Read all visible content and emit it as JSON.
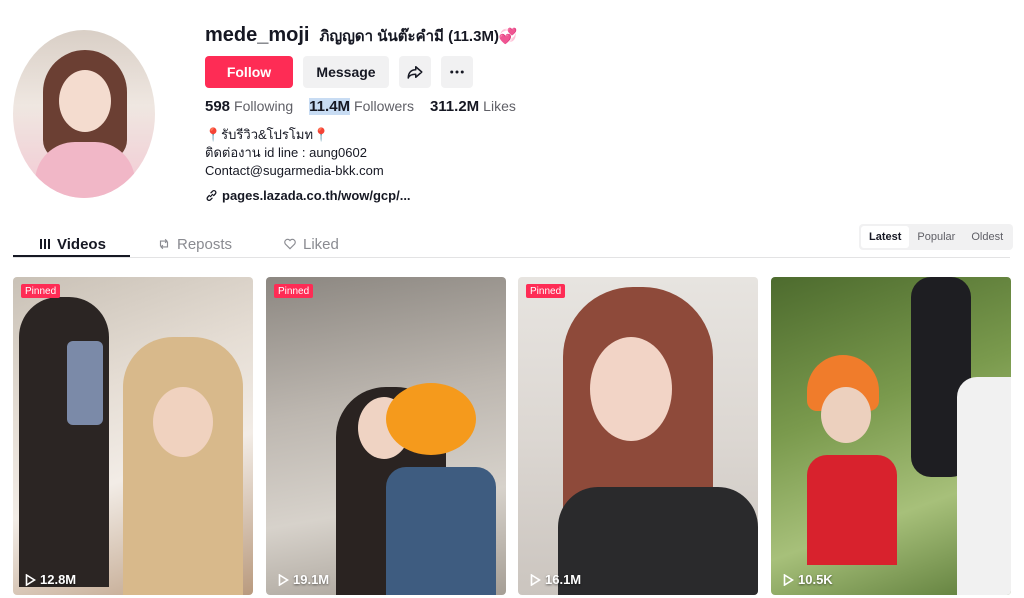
{
  "profile": {
    "username": "mede_moji",
    "nickname": "ภิญญดา นันต๊ะคำมี (11.3M)💞",
    "follow_label": "Follow",
    "message_label": "Message",
    "stats": {
      "following_value": "598",
      "following_label": "Following",
      "followers_value": "11.4M",
      "followers_label": "Followers",
      "likes_value": "311.2M",
      "likes_label": "Likes"
    },
    "bio": {
      "line1": "📍รับรีวิว&โปรโมท📍",
      "line2": "ติดต่องาน id line : aung0602",
      "line3": "Contact@sugarmedia-bkk.com"
    },
    "link": "pages.lazada.co.th/wow/gcp/..."
  },
  "tabs": [
    {
      "label": "Videos",
      "icon": "grid-icon"
    },
    {
      "label": "Reposts",
      "icon": "repost-icon"
    },
    {
      "label": "Liked",
      "icon": "heart-icon"
    }
  ],
  "sort": [
    "Latest",
    "Popular",
    "Oldest"
  ],
  "videos": [
    {
      "pinned": "Pinned",
      "views": "12.8M"
    },
    {
      "pinned": "Pinned",
      "views": "19.1M"
    },
    {
      "pinned": "Pinned",
      "views": "16.1M"
    },
    {
      "pinned": "",
      "views": "10.5K"
    }
  ],
  "colors": {
    "accent": "#fe2c55",
    "text": "#161823",
    "muted": "#5f5f66"
  }
}
